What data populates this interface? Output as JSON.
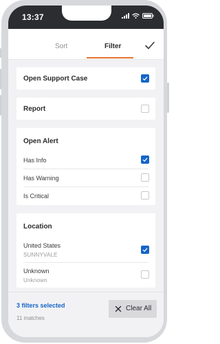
{
  "status_bar": {
    "time": "13:37"
  },
  "tabs": {
    "sort_label": "Sort",
    "filter_label": "Filter",
    "active": "Filter"
  },
  "filters": {
    "open_support_case": {
      "label": "Open Support Case",
      "checked": true
    },
    "report": {
      "label": "Report",
      "checked": false
    },
    "open_alert": {
      "title": "Open Alert",
      "options": [
        {
          "label": "Has Info",
          "checked": true
        },
        {
          "label": "Has Warning",
          "checked": false
        },
        {
          "label": "Is Critical",
          "checked": false
        }
      ]
    },
    "location": {
      "title": "Location",
      "options": [
        {
          "label": "United States",
          "sublabel": "SUNNYVALE",
          "checked": true
        },
        {
          "label": "Unknown",
          "sublabel": "Unknown",
          "checked": false
        }
      ]
    }
  },
  "footer": {
    "selected_text": "3 filters selected",
    "matches_text": "11 matches",
    "clear_label": "Clear All"
  },
  "colors": {
    "accent": "#e8742f",
    "primary": "#1565c8",
    "status_bar": "#2b2d31"
  }
}
